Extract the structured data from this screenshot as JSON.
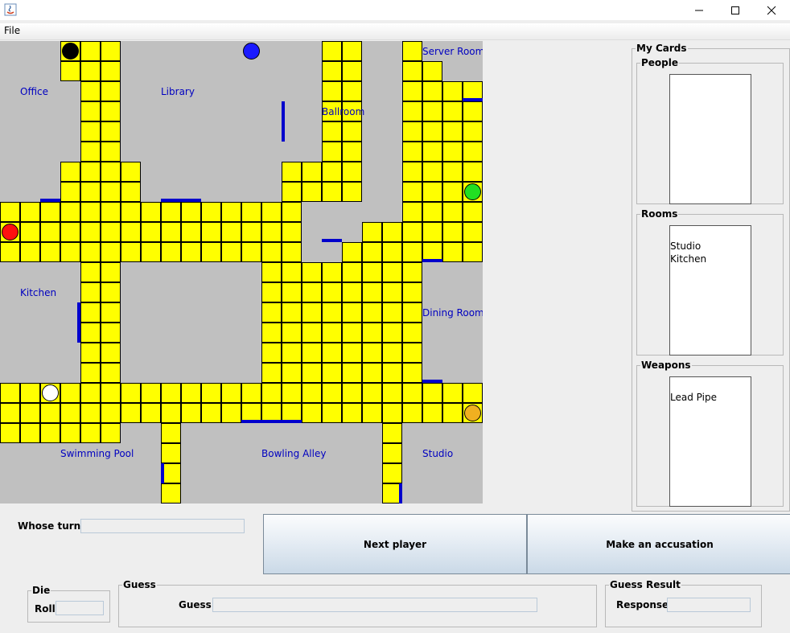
{
  "menu": {
    "file_label": "File"
  },
  "board": {
    "cols": 24,
    "rows": 23,
    "walkable_rows": [
      "   ###          ##  #   ",
      "   ###          ##  ##  ",
      "    ##          ##  ####",
      "    ##          ##  ####",
      "    ##          ##  ####",
      "    ##          ##  ####",
      "   ####       ####  ####",
      "   ####       ####  ####",
      "###############     ####",
      "###############   ######",
      "###############  #######",
      "    ##       ########   ",
      "    ##       ########   ",
      "    ##       ########   ",
      "    ##       ########   ",
      "    ##       ########   ",
      "    ##       ########   ",
      "########################",
      "########################",
      "######  #          #    ",
      "        #          #    ",
      "        #          #    ",
      "        #          #    "
    ],
    "doors": [
      {
        "side": "bottom",
        "row": 7,
        "col": 2
      },
      {
        "side": "bottom",
        "row": 7,
        "col": 8
      },
      {
        "side": "bottom",
        "row": 7,
        "col": 9
      },
      {
        "side": "left",
        "row": 3,
        "col": 14
      },
      {
        "side": "left",
        "row": 4,
        "col": 14
      },
      {
        "side": "bottom",
        "row": 9,
        "col": 16
      },
      {
        "side": "bottom",
        "row": 2,
        "col": 23
      },
      {
        "side": "bottom",
        "row": 10,
        "col": 21
      },
      {
        "side": "right",
        "row": 13,
        "col": 3
      },
      {
        "side": "right",
        "row": 14,
        "col": 3
      },
      {
        "side": "bottom",
        "row": 16,
        "col": 21
      },
      {
        "side": "bottom",
        "row": 18,
        "col": 12
      },
      {
        "side": "bottom",
        "row": 18,
        "col": 13
      },
      {
        "side": "bottom",
        "row": 18,
        "col": 14
      },
      {
        "side": "left",
        "row": 21,
        "col": 8
      },
      {
        "side": "right",
        "row": 22,
        "col": 19
      }
    ],
    "rooms": [
      {
        "name": "Office",
        "row": 2,
        "col": 1
      },
      {
        "name": "Library",
        "row": 2,
        "col": 8
      },
      {
        "name": "Server Room",
        "row": 0,
        "col": 21
      },
      {
        "name": "Ballroom",
        "row": 3,
        "col": 16
      },
      {
        "name": "Kitchen",
        "row": 12,
        "col": 1
      },
      {
        "name": "Dining Room",
        "row": 13,
        "col": 21
      },
      {
        "name": "Swimming Pool",
        "row": 20,
        "col": 3
      },
      {
        "name": "Bowling Alley",
        "row": 20,
        "col": 13
      },
      {
        "name": "Studio",
        "row": 20,
        "col": 21
      }
    ],
    "tokens": [
      {
        "color": "#000000",
        "row": 0,
        "col": 3
      },
      {
        "color": "#1a1aff",
        "row": 0,
        "col": 12
      },
      {
        "color": "#22e022",
        "row": 7,
        "col": 23
      },
      {
        "color": "#ff1010",
        "row": 9,
        "col": 0
      },
      {
        "color": "#ffffff",
        "row": 17,
        "col": 2
      },
      {
        "color": "#f0b020",
        "row": 18,
        "col": 23
      }
    ],
    "colors": {
      "room": "#c0c0c0",
      "tile": "#ffff00",
      "door": "#0000cc",
      "room_label": "#0000c0",
      "grid": "#000000"
    }
  },
  "cards": {
    "title": "My Cards",
    "people": {
      "label": "People",
      "items": []
    },
    "rooms": {
      "label": "Rooms",
      "items": [
        "Studio",
        "Kitchen"
      ]
    },
    "weapons": {
      "label": "Weapons",
      "items": [
        "Lead Pipe"
      ]
    }
  },
  "turn": {
    "label": "Whose turn?",
    "value": ""
  },
  "buttons": {
    "next_player": "Next player",
    "accusation": "Make an accusation"
  },
  "die": {
    "title": "Die",
    "roll_label": "Roll",
    "roll_value": ""
  },
  "guess": {
    "title": "Guess",
    "label": "Guess",
    "value": ""
  },
  "guess_result": {
    "title": "Guess Result",
    "response_label": "Response",
    "value": ""
  }
}
